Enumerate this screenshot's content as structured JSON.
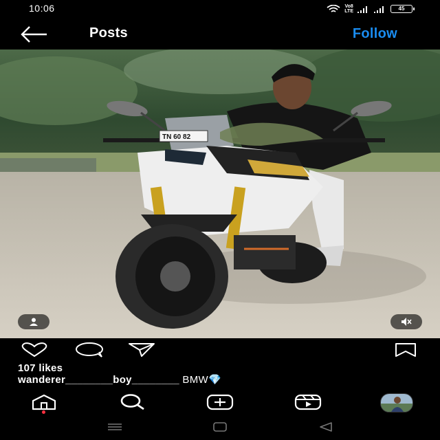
{
  "status_bar": {
    "time": "10:06",
    "volte_line1": "Vo8",
    "volte_line2": "LTE",
    "battery": "45"
  },
  "header": {
    "back_icon": "arrow-left-icon",
    "title": "Posts",
    "follow_label": "Follow",
    "follow_color": "#1a8cf0"
  },
  "post": {
    "image_alt": "man-riding-motorcycle",
    "plate_text": "TN 60 82",
    "user_tag_icon": "person-icon",
    "mute_icon": "speaker-muted-icon",
    "likes": "107 likes",
    "caption_user": "wanderer________boy________",
    "caption_text": "BMW",
    "caption_emoji": "💎"
  },
  "actions": {
    "like_icon": "heart-outline-icon",
    "comment_icon": "comment-bubble-icon",
    "share_icon": "paper-plane-icon",
    "save_icon": "bookmark-icon"
  },
  "bottom_nav": {
    "items": [
      "home-icon",
      "search-icon",
      "create-icon",
      "reels-icon",
      "profile-avatar"
    ],
    "notification_dot_color": "#ff3040"
  },
  "android_nav": {
    "items": [
      "recents-icon",
      "home-square-icon",
      "back-triangle-icon"
    ]
  }
}
